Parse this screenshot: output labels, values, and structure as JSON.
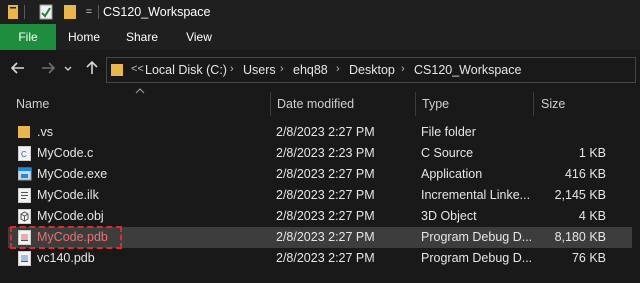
{
  "window": {
    "title": "CS120_Workspace",
    "quick_access_dropdown": "="
  },
  "ribbon": {
    "tabs": [
      {
        "label": "File"
      },
      {
        "label": "Home"
      },
      {
        "label": "Share"
      },
      {
        "label": "View"
      }
    ]
  },
  "address": {
    "overflow": "<<",
    "crumbs": [
      "Local Disk (C:)",
      "Users",
      "ehq88",
      "Desktop",
      "CS120_Workspace"
    ]
  },
  "columns": [
    "Name",
    "Date modified",
    "Type",
    "Size"
  ],
  "files": [
    {
      "name": ".vs",
      "date": "2/8/2023 2:27 PM",
      "type": "File folder",
      "size": "",
      "icon": "folder-icon"
    },
    {
      "name": "MyCode.c",
      "date": "2/8/2023 2:23 PM",
      "type": "C Source",
      "size": "1 KB",
      "icon": "c-source-file-icon"
    },
    {
      "name": "MyCode.exe",
      "date": "2/8/2023 2:27 PM",
      "type": "Application",
      "size": "416 KB",
      "icon": "application-icon"
    },
    {
      "name": "MyCode.ilk",
      "date": "2/8/2023 2:27 PM",
      "type": "Incremental Linke...",
      "size": "2,145 KB",
      "icon": "ilk-file-icon"
    },
    {
      "name": "MyCode.obj",
      "date": "2/8/2023 2:27 PM",
      "type": "3D Object",
      "size": "4 KB",
      "icon": "3d-object-icon"
    },
    {
      "name": "MyCode.pdb",
      "date": "2/8/2023 2:27 PM",
      "type": "Program Debug D...",
      "size": "8,180 KB",
      "icon": "pdb-file-icon",
      "selected": true
    },
    {
      "name": "vc140.pdb",
      "date": "2/8/2023 2:27 PM",
      "type": "Program Debug D...",
      "size": "76 KB",
      "icon": "pdb-file-icon"
    }
  ],
  "colors": {
    "file_tab": "#1e8e3e",
    "highlight_box": "#d32f2f",
    "folder": "#e8b64c",
    "selected_row": "#3d3d3d"
  }
}
